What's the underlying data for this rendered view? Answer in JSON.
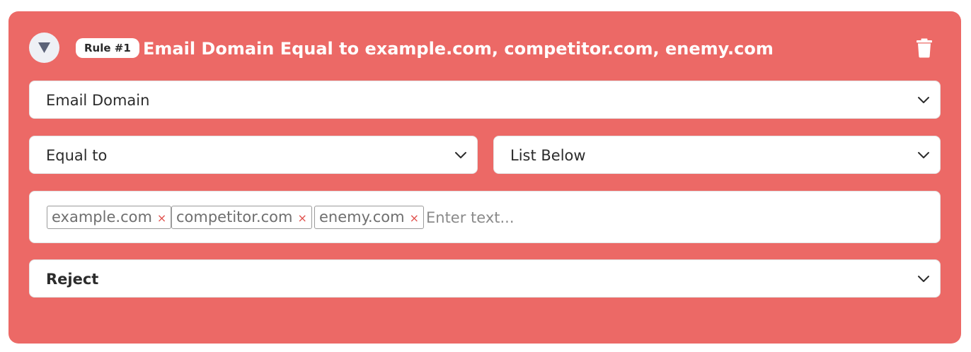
{
  "rule": {
    "badge": "Rule #1",
    "title": "Email Domain Equal to example.com, competitor.com, enemy.com"
  },
  "icons": {
    "toggle": "triangle-down-icon",
    "delete": "trash-icon",
    "dropdown": "chevron-down-icon",
    "remove_tag": "close-icon"
  },
  "fields": {
    "attribute": "Email Domain",
    "operator": "Equal to",
    "value_source": "List Below",
    "action": "Reject"
  },
  "tags": {
    "items": [
      "example.com",
      "competitor.com",
      "enemy.com"
    ],
    "remove_symbol": "×",
    "placeholder": "Enter text..."
  },
  "colors": {
    "card_background": "#ec6966",
    "tag_remove": "#e0504c"
  }
}
